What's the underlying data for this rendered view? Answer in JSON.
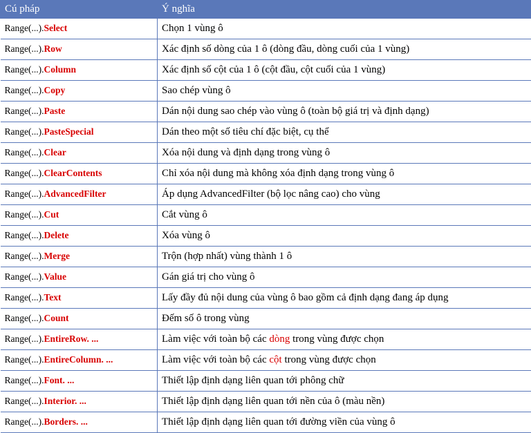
{
  "header": {
    "syntax": "Cú pháp",
    "meaning": "Ý nghĩa"
  },
  "rows": [
    {
      "prefix": "Range(...).",
      "method": "Select",
      "meaning": [
        {
          "t": "Chọn 1 vùng ô"
        }
      ]
    },
    {
      "prefix": "Range(...).",
      "method": "Row",
      "meaning": [
        {
          "t": "Xác định số dòng của 1 ô (dòng đầu, dòng cuối của 1 vùng)"
        }
      ]
    },
    {
      "prefix": "Range(...).",
      "method": "Column",
      "meaning": [
        {
          "t": "Xác định số cột của 1 ô (cột đầu, cột cuối của 1 vùng)"
        }
      ]
    },
    {
      "prefix": "Range(...).",
      "method": "Copy",
      "meaning": [
        {
          "t": "Sao chép vùng ô"
        }
      ]
    },
    {
      "prefix": "Range(...).",
      "method": "Paste",
      "meaning": [
        {
          "t": "Dán nội dung sao chép vào vùng ô (toàn bộ giá trị và định dạng)"
        }
      ]
    },
    {
      "prefix": "Range(...).",
      "method": "PasteSpecial",
      "meaning": [
        {
          "t": "Dán theo một số tiêu chí đặc biệt, cụ thể"
        }
      ]
    },
    {
      "prefix": "Range(...).",
      "method": "Clear",
      "meaning": [
        {
          "t": "Xóa nội dung và định dạng trong vùng ô"
        }
      ]
    },
    {
      "prefix": "Range(...).",
      "method": "ClearContents",
      "meaning": [
        {
          "t": "Chỉ xóa nội dung mà không xóa định dạng trong vùng ô"
        }
      ]
    },
    {
      "prefix": "Range(...).",
      "method": "AdvancedFilter",
      "meaning": [
        {
          "t": "Áp dụng AdvancedFilter (bộ lọc nâng cao) cho vùng"
        }
      ]
    },
    {
      "prefix": "Range(...).",
      "method": "Cut",
      "meaning": [
        {
          "t": "Cắt vùng ô"
        }
      ]
    },
    {
      "prefix": "Range(...).",
      "method": "Delete",
      "meaning": [
        {
          "t": "Xóa vùng ô"
        }
      ]
    },
    {
      "prefix": "Range(...).",
      "method": "Merge",
      "meaning": [
        {
          "t": "Trộn (hợp nhất) vùng thành 1 ô"
        }
      ]
    },
    {
      "prefix": "Range(...).",
      "method": "Value",
      "meaning": [
        {
          "t": "Gán giá trị cho vùng ô"
        }
      ]
    },
    {
      "prefix": "Range(...).",
      "method": "Text",
      "meaning": [
        {
          "t": "Lấy đầy đủ nội dung của vùng ô bao gồm cả định dạng đang áp dụng"
        }
      ]
    },
    {
      "prefix": "Range(...).",
      "method": "Count",
      "meaning": [
        {
          "t": "Đếm số ô trong vùng"
        }
      ]
    },
    {
      "prefix": "Range(...).",
      "method": "EntireRow. ...",
      "meaning": [
        {
          "t": "Làm việc với toàn bộ các "
        },
        {
          "t": "dòng",
          "hl": true
        },
        {
          "t": " trong vùng được chọn"
        }
      ]
    },
    {
      "prefix": "Range(...).",
      "method": "EntireColumn. ...",
      "meaning": [
        {
          "t": "Làm việc với toàn bộ các "
        },
        {
          "t": "cột",
          "hl": true
        },
        {
          "t": " trong vùng được chọn"
        }
      ]
    },
    {
      "prefix": "Range(...).",
      "method": "Font. ...",
      "meaning": [
        {
          "t": "Thiết lập định dạng liên quan tới phông chữ"
        }
      ]
    },
    {
      "prefix": "Range(...).",
      "method": "Interior. ...",
      "meaning": [
        {
          "t": "Thiết lập định dạng liên quan tới nền của ô (màu nền)"
        }
      ]
    },
    {
      "prefix": "Range(...).",
      "method": "Borders. ...",
      "meaning": [
        {
          "t": "Thiết lập định dạng liên quan tới đường viền của vùng ô"
        }
      ]
    }
  ]
}
